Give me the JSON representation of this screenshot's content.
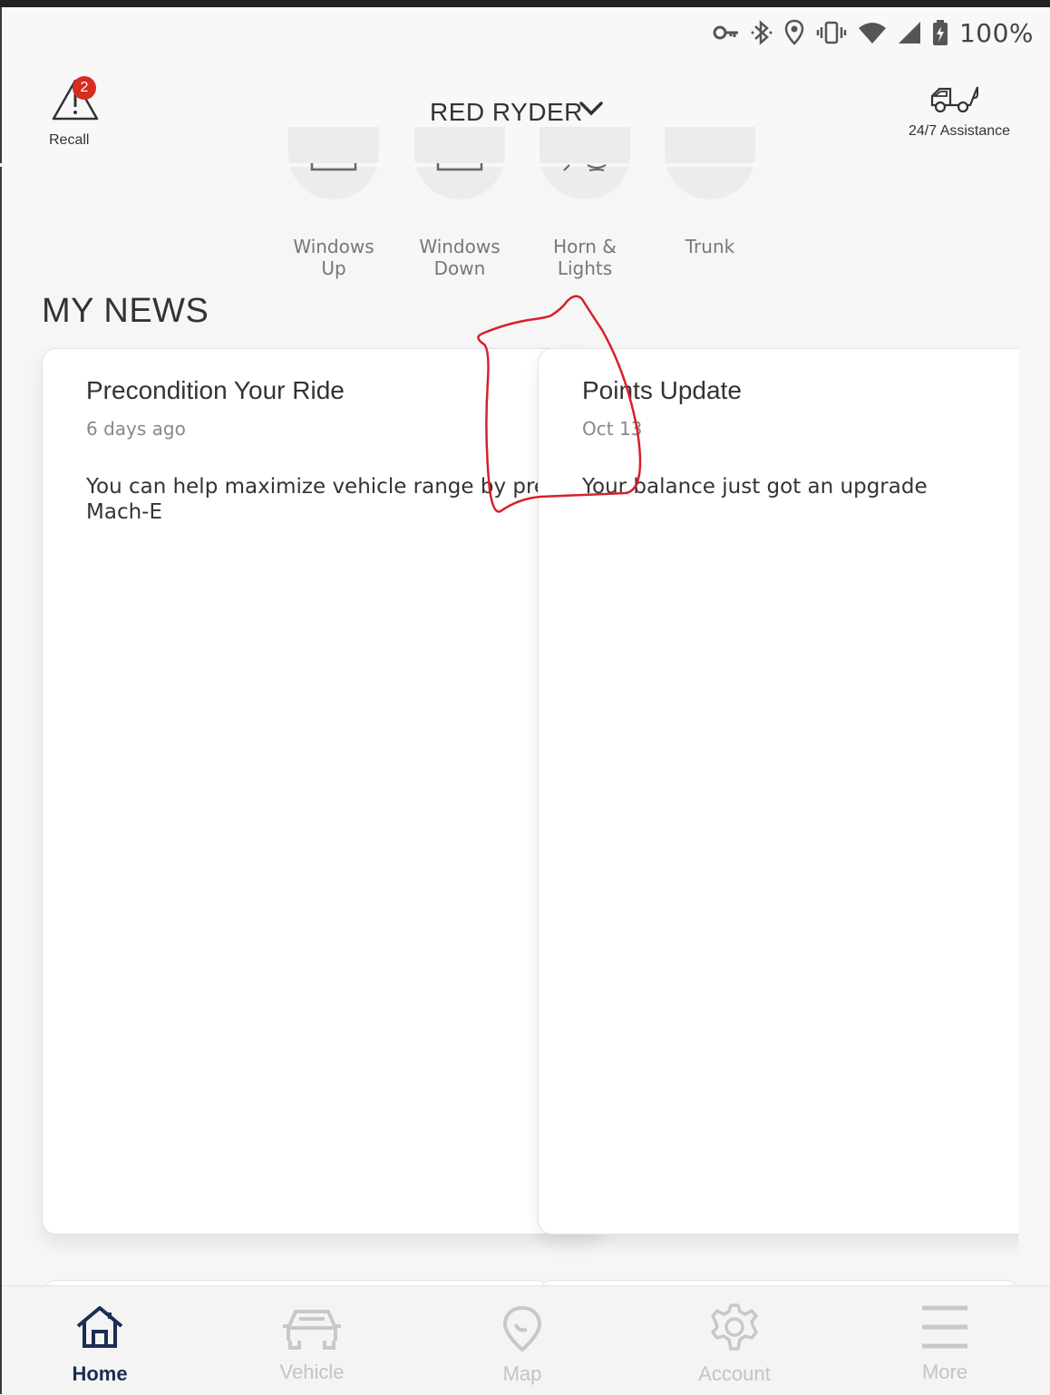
{
  "status_bar": {
    "battery": "100%"
  },
  "header": {
    "recall_label": "Recall",
    "recall_count": "2",
    "vehicle_name": "RED RYDER",
    "assistance_label": "24/7 Assistance"
  },
  "quick_actions": [
    {
      "line1": "Windows",
      "line2": "Up"
    },
    {
      "line1": "Windows",
      "line2": "Down"
    },
    {
      "line1": "Horn &",
      "line2": "Lights"
    },
    {
      "line1": "Trunk",
      "line2": ""
    }
  ],
  "news": {
    "title": "MY NEWS",
    "cards": [
      {
        "title": "Precondition Your Ride",
        "date": "6 days ago",
        "body": "You can help maximize vehicle range by pre",
        "body2": "Mach-E"
      },
      {
        "title": "Points Update",
        "date": "Oct 13",
        "body": "Your balance just got an upgrade"
      }
    ]
  },
  "nav": [
    {
      "label": "Home",
      "icon": "home-icon",
      "active": true
    },
    {
      "label": "Vehicle",
      "icon": "car-icon"
    },
    {
      "label": "Map",
      "icon": "map-pin-icon"
    },
    {
      "label": "Account",
      "icon": "gear-icon"
    },
    {
      "label": "More",
      "icon": "menu-icon"
    }
  ],
  "colors": {
    "badge": "#d62d20",
    "nav_active": "#1c2d53",
    "annotation": "#d6202a"
  }
}
